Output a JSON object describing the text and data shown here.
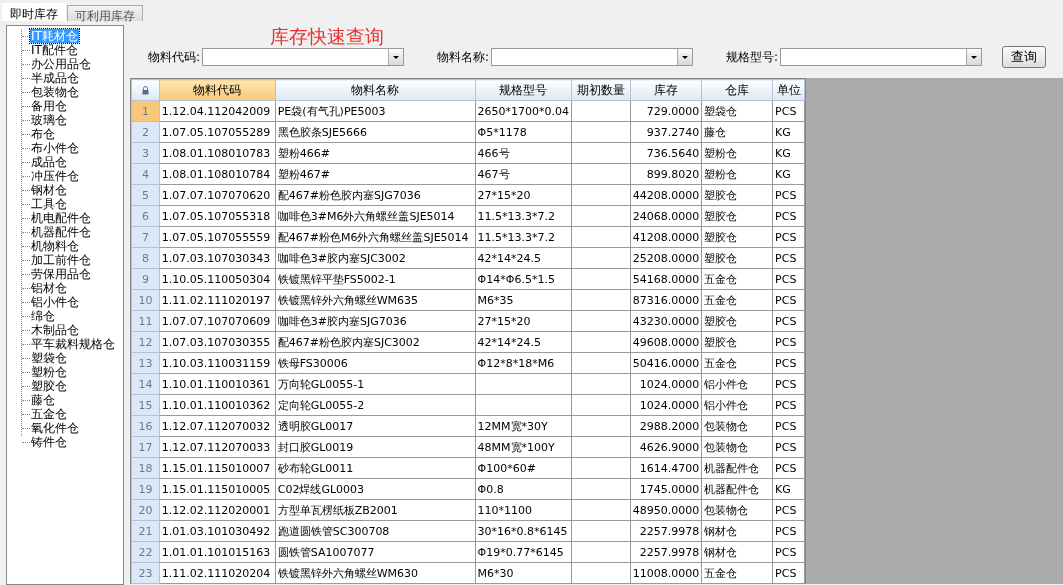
{
  "tabs": [
    {
      "label": "即时库存",
      "selected": true
    },
    {
      "label": "可利用库存",
      "selected": false
    }
  ],
  "warehouse_tree": {
    "items": [
      {
        "label": "IT耗材仓",
        "selected": true
      },
      {
        "label": "IT配件仓",
        "selected": false
      },
      {
        "label": "办公用品仓",
        "selected": false
      },
      {
        "label": "半成品仓",
        "selected": false
      },
      {
        "label": "包装物仓",
        "selected": false
      },
      {
        "label": "备用仓",
        "selected": false
      },
      {
        "label": "玻璃仓",
        "selected": false
      },
      {
        "label": "布仓",
        "selected": false
      },
      {
        "label": "布小件仓",
        "selected": false
      },
      {
        "label": "成品仓",
        "selected": false
      },
      {
        "label": "冲压件仓",
        "selected": false
      },
      {
        "label": "钢材仓",
        "selected": false
      },
      {
        "label": "工具仓",
        "selected": false
      },
      {
        "label": "机电配件仓",
        "selected": false
      },
      {
        "label": "机器配件仓",
        "selected": false
      },
      {
        "label": "机物料仓",
        "selected": false
      },
      {
        "label": "加工前件仓",
        "selected": false
      },
      {
        "label": "劳保用品仓",
        "selected": false
      },
      {
        "label": "铝材仓",
        "selected": false
      },
      {
        "label": "铝小件仓",
        "selected": false
      },
      {
        "label": "绵仓",
        "selected": false
      },
      {
        "label": "木制品仓",
        "selected": false
      },
      {
        "label": "平车裁料规格仓",
        "selected": false
      },
      {
        "label": "塑袋仓",
        "selected": false
      },
      {
        "label": "塑粉仓",
        "selected": false
      },
      {
        "label": "塑胶仓",
        "selected": false
      },
      {
        "label": "藤仓",
        "selected": false
      },
      {
        "label": "五金仓",
        "selected": false
      },
      {
        "label": "氧化件仓",
        "selected": false
      },
      {
        "label": "铸件仓",
        "selected": false
      }
    ]
  },
  "title": "库存快速查询",
  "filters": [
    {
      "label": "物料代码:"
    },
    {
      "label": "物料名称:"
    },
    {
      "label": "规格型号:"
    }
  ],
  "query_button": "查询",
  "table": {
    "columns": [
      {
        "label": "物料代码",
        "selected": true
      },
      {
        "label": "物料名称",
        "selected": false
      },
      {
        "label": "规格型号",
        "selected": false
      },
      {
        "label": "期初数量",
        "selected": false
      },
      {
        "label": "库存",
        "selected": false
      },
      {
        "label": "仓库",
        "selected": false
      },
      {
        "label": "单位",
        "selected": false
      }
    ],
    "rows": [
      {
        "number": "1",
        "selected": true,
        "code": "1.12.04.112042009",
        "name": "PE袋(有气孔)PE5003",
        "spec": "2650*1700*0.04",
        "stock": "729.0000",
        "warehouse": "塑袋仓",
        "unit": "PCS"
      },
      {
        "number": "2",
        "selected": false,
        "code": "1.07.05.107055289",
        "name": "黑色胶条SJE5666",
        "spec": "Φ5*1178",
        "stock": "937.2740",
        "warehouse": "藤仓",
        "unit": "KG"
      },
      {
        "number": "3",
        "selected": false,
        "code": "1.08.01.108010783",
        "name": "塑粉466#",
        "spec": "466号",
        "stock": "736.5640",
        "warehouse": "塑粉仓",
        "unit": "KG"
      },
      {
        "number": "4",
        "selected": false,
        "code": "1.08.01.108010784",
        "name": "塑粉467#",
        "spec": "467号",
        "stock": "899.8020",
        "warehouse": "塑粉仓",
        "unit": "KG"
      },
      {
        "number": "5",
        "selected": false,
        "code": "1.07.07.107070620",
        "name": "配467#粉色胶内塞SJG7036",
        "spec": "27*15*20",
        "stock": "44208.0000",
        "warehouse": "塑胶仓",
        "unit": "PCS"
      },
      {
        "number": "6",
        "selected": false,
        "code": "1.07.05.107055318",
        "name": "咖啡色3#M6外六角螺丝盖SJE5014",
        "spec": "11.5*13.3*7.2",
        "stock": "24068.0000",
        "warehouse": "塑胶仓",
        "unit": "PCS"
      },
      {
        "number": "7",
        "selected": false,
        "code": "1.07.05.107055559",
        "name": "配467#粉色M6外六角螺丝盖SJE5014",
        "spec": "11.5*13.3*7.2",
        "stock": "41208.0000",
        "warehouse": "塑胶仓",
        "unit": "PCS"
      },
      {
        "number": "8",
        "selected": false,
        "code": "1.07.03.107030343",
        "name": "咖啡色3#胶内塞SJC3002",
        "spec": "42*14*24.5",
        "stock": "25208.0000",
        "warehouse": "塑胶仓",
        "unit": "PCS"
      },
      {
        "number": "9",
        "selected": false,
        "code": "1.10.05.110050304",
        "name": "铁镀黑锌平垫FS5002-1",
        "spec": "Φ14*Φ6.5*1.5",
        "stock": "54168.0000",
        "warehouse": "五金仓",
        "unit": "PCS"
      },
      {
        "number": "10",
        "selected": false,
        "code": "1.11.02.111020197",
        "name": "铁镀黑锌外六角螺丝WM635",
        "spec": "M6*35",
        "stock": "87316.0000",
        "warehouse": "五金仓",
        "unit": "PCS"
      },
      {
        "number": "11",
        "selected": false,
        "code": "1.07.07.107070609",
        "name": "咖啡色3#胶内塞SJG7036",
        "spec": "27*15*20",
        "stock": "43230.0000",
        "warehouse": "塑胶仓",
        "unit": "PCS"
      },
      {
        "number": "12",
        "selected": false,
        "code": "1.07.03.107030355",
        "name": "配467#粉色胶内塞SJC3002",
        "spec": "42*14*24.5",
        "stock": "49608.0000",
        "warehouse": "塑胶仓",
        "unit": "PCS"
      },
      {
        "number": "13",
        "selected": false,
        "code": "1.10.03.110031159",
        "name": "铁母FS30006",
        "spec": "Φ12*8*18*M6",
        "stock": "50416.0000",
        "warehouse": "五金仓",
        "unit": "PCS"
      },
      {
        "number": "14",
        "selected": false,
        "code": "1.10.01.110010361",
        "name": "万向轮GL0055-1",
        "stock": "1024.0000",
        "warehouse": "铝小件仓",
        "unit": "PCS"
      },
      {
        "number": "15",
        "selected": false,
        "code": "1.10.01.110010362",
        "name": "定向轮GL0055-2",
        "stock": "1024.0000",
        "warehouse": "铝小件仓",
        "unit": "PCS"
      },
      {
        "number": "16",
        "selected": false,
        "code": "1.12.07.112070032",
        "name": "透明胶GL0017",
        "spec": "12MM宽*30Y",
        "stock": "2988.2000",
        "warehouse": "包装物仓",
        "unit": "PCS"
      },
      {
        "number": "17",
        "selected": false,
        "code": "1.12.07.112070033",
        "name": "封口胶GL0019",
        "spec": "48MM宽*100Y",
        "stock": "4626.9000",
        "warehouse": "包装物仓",
        "unit": "PCS"
      },
      {
        "number": "18",
        "selected": false,
        "code": "1.15.01.115010007",
        "name": "砂布轮GL0011",
        "spec": "Φ100*60#",
        "stock": "1614.4700",
        "warehouse": "机器配件仓",
        "unit": "PCS"
      },
      {
        "number": "19",
        "selected": false,
        "code": "1.15.01.115010005",
        "name": "C02焊线GL0003",
        "spec": "Φ0.8",
        "stock": "1745.0000",
        "warehouse": "机器配件仓",
        "unit": "KG"
      },
      {
        "number": "20",
        "selected": false,
        "code": "1.12.02.112020001",
        "name": "方型单瓦楞纸板ZB2001",
        "spec": "110*1100",
        "stock": "48950.0000",
        "warehouse": "包装物仓",
        "unit": "PCS"
      },
      {
        "number": "21",
        "selected": false,
        "code": "1.01.03.101030492",
        "name": "跑道圆铁管SC300708",
        "spec": "30*16*0.8*6145",
        "stock": "2257.9978",
        "warehouse": "钢材仓",
        "unit": "PCS"
      },
      {
        "number": "22",
        "selected": false,
        "code": "1.01.01.101015163",
        "name": "圆铁管SA1007077",
        "spec": "Φ19*0.77*6145",
        "stock": "2257.9978",
        "warehouse": "钢材仓",
        "unit": "PCS"
      },
      {
        "number": "23",
        "selected": false,
        "code": "1.11.02.111020204",
        "name": "铁镀黑锌外六角螺丝WM630",
        "spec": "M6*30",
        "stock": "11008.0000",
        "warehouse": "五金仓",
        "unit": "PCS"
      }
    ]
  }
}
